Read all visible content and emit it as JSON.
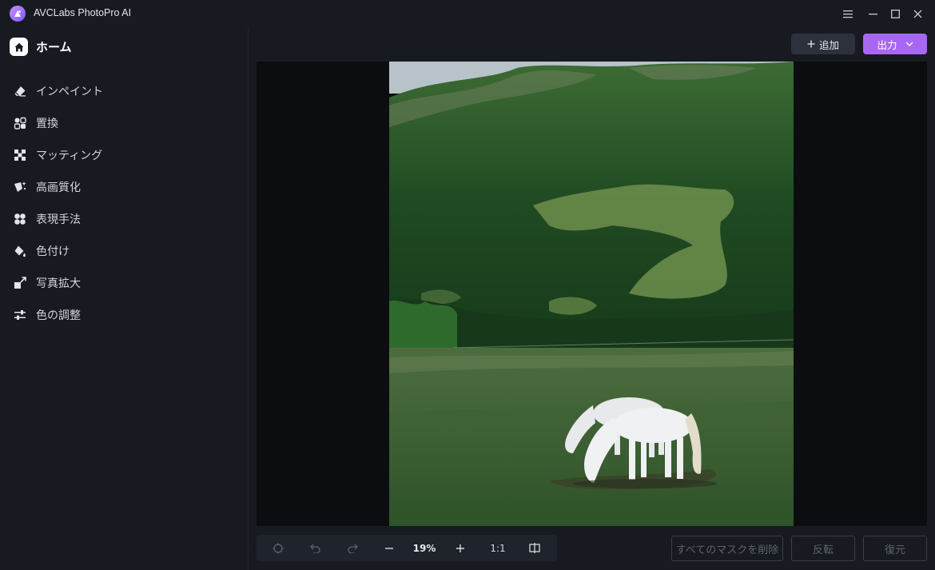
{
  "app": {
    "title": "AVCLabs PhotoPro AI"
  },
  "window_controls": {
    "menu": "☰",
    "minimize": "—",
    "maximize": "☐",
    "close": "✕"
  },
  "sidebar": {
    "home_label": "ホーム",
    "items": [
      {
        "label": "インペイント",
        "icon": "eraser-icon"
      },
      {
        "label": "置換",
        "icon": "shapes-icon"
      },
      {
        "label": "マッティング",
        "icon": "matting-icon"
      },
      {
        "label": "高画質化",
        "icon": "sparkle-enhance-icon"
      },
      {
        "label": "表現手法",
        "icon": "style-icon"
      },
      {
        "label": "色付け",
        "icon": "paint-bucket-icon"
      },
      {
        "label": "写真拡大",
        "icon": "expand-icon"
      },
      {
        "label": "色の調整",
        "icon": "sliders-icon"
      }
    ]
  },
  "toolbar": {
    "add_label": "追加",
    "export_label": "出力"
  },
  "zoom": {
    "value": "19%",
    "ratio": "1:1"
  },
  "actions": {
    "clear_masks": "すべてのマスクを削除",
    "invert": "反転",
    "restore": "復元"
  },
  "colors": {
    "accent": "#a867f2",
    "background": "#171a21",
    "canvas": "#0b0d11"
  }
}
